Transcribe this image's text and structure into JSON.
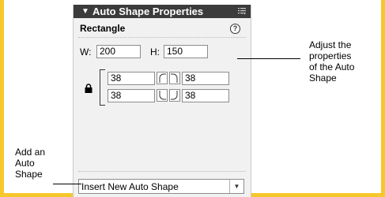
{
  "panel": {
    "title": "Auto Shape Properties",
    "title_arrow": "▼",
    "shape_name": "Rectangle",
    "help": "?",
    "width_label": "W:",
    "width_value": "200",
    "height_label": "H:",
    "height_value": "150",
    "corner_radius": {
      "top_left": "38",
      "top_right": "38",
      "bottom_left": "38",
      "bottom_right": "38"
    },
    "insert_select": {
      "value": "Insert New Auto Shape",
      "arrow": "▼"
    }
  },
  "callouts": {
    "right": [
      "Adjust the",
      "properties",
      "of the Auto",
      "Shape"
    ],
    "left": [
      "Add an",
      "Auto",
      "Shape"
    ]
  },
  "colors": {
    "frame": "#F7C82B",
    "titlebar": "#3b3b3b",
    "panel_bg": "#F1F1F1"
  },
  "icons": [
    "panel-menu-icon",
    "help-icon",
    "lock-icon",
    "corner-top-left-icon",
    "corner-top-right-icon",
    "corner-bottom-left-icon",
    "corner-bottom-right-icon",
    "dropdown-arrow-icon"
  ]
}
